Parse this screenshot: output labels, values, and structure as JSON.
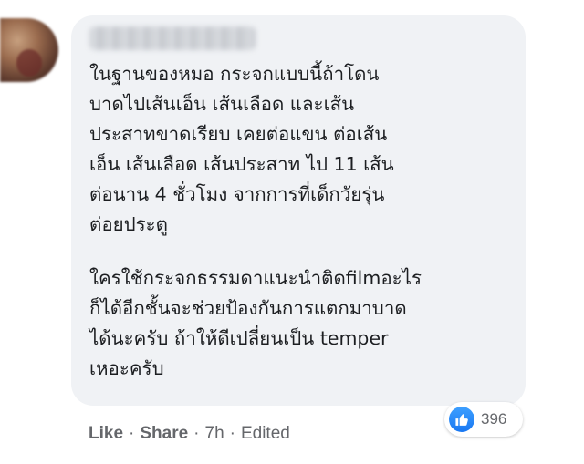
{
  "comment": {
    "author_name_redacted": true,
    "paragraph_1": [
      "ในฐานของหมอ กระจกแบบนี้ถ้าโดน",
      "บาดไปเส้นเอ็น เส้นเลือด และเส้น",
      "ประสาทขาดเรียบ เคยต่อแขน ต่อเส้น",
      "เอ็น เส้นเลือด เส้นประสาท ไป 11 เส้น",
      "ต่อนาน 4 ชั่วโมง จากการที่เด็กวัยรุ่น",
      "ต่อยประตู"
    ],
    "paragraph_2": [
      "ใครใช้กระจกธรรมดาแนะนำติดfilmอะไร",
      "ก็ได้อีกชั้นจะช่วยป้องกันการแตกมาบาด",
      "ได้นะครับ ถ้าให้ดีเปลี่ยนเป็น temper",
      "เหอะครับ"
    ]
  },
  "reactions": {
    "icon": "thumbs-up-icon",
    "count": "396",
    "color": "#1877f2"
  },
  "actions": {
    "like_label": "Like",
    "separator": "·",
    "share_label": "Share",
    "time": "7h",
    "edited_label": "Edited"
  },
  "colors": {
    "bubble_bg": "#f0f2f5",
    "text": "#1c1e21",
    "meta": "#65676b"
  }
}
